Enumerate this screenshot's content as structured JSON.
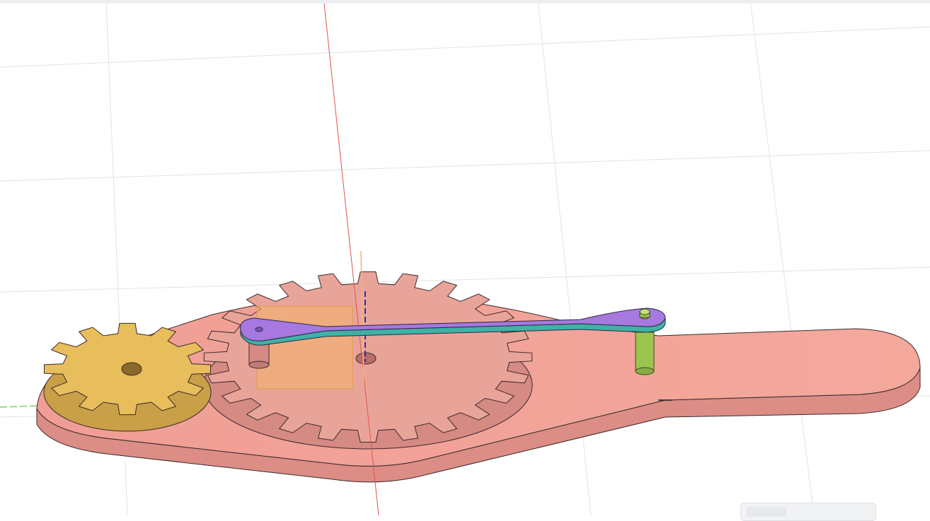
{
  "app": "3D CAD viewport",
  "viewport": {
    "background": "#ffffff",
    "grid_color": "#e2e3e5",
    "axes": {
      "x": "#7ccf6a",
      "y": "#e0554b",
      "z": "#1c2fd6"
    }
  },
  "model": {
    "base_plate_color": "#ef9c92",
    "small_gear": {
      "color": "#e8bd5c",
      "teeth": 12
    },
    "large_gear": {
      "color": "#e9a49a",
      "teeth": 24
    },
    "link_arm_color": "#a678e0",
    "pin_color": "#9dc451",
    "origin_plane_color": "#f4b36a"
  },
  "view_controls": {
    "icon": "navigation-bar-icon"
  }
}
